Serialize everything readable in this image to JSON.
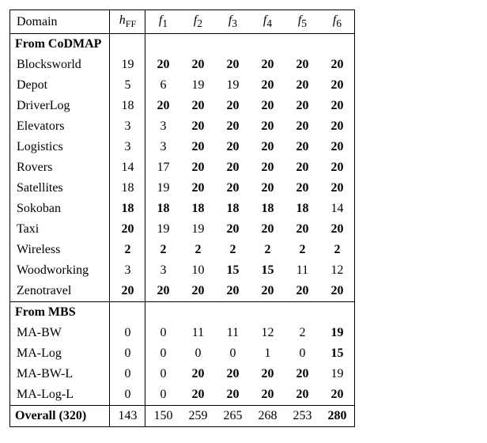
{
  "headers": [
    "Domain",
    "h_FF",
    "f_1",
    "f_2",
    "f_3",
    "f_4",
    "f_5",
    "f_6"
  ],
  "chart_data": {
    "type": "table",
    "columns": [
      "Domain",
      "h_FF",
      "f_1",
      "f_2",
      "f_3",
      "f_4",
      "f_5",
      "f_6"
    ],
    "sections": [
      {
        "title": "From CoDMAP",
        "rows": [
          {
            "domain": "Blocksworld",
            "values": [
              19,
              20,
              20,
              20,
              20,
              20,
              20
            ],
            "bold": [
              false,
              true,
              true,
              true,
              true,
              true,
              true
            ]
          },
          {
            "domain": "Depot",
            "values": [
              5,
              6,
              19,
              19,
              20,
              20,
              20
            ],
            "bold": [
              false,
              false,
              false,
              false,
              true,
              true,
              true
            ]
          },
          {
            "domain": "DriverLog",
            "values": [
              18,
              20,
              20,
              20,
              20,
              20,
              20
            ],
            "bold": [
              false,
              true,
              true,
              true,
              true,
              true,
              true
            ]
          },
          {
            "domain": "Elevators",
            "values": [
              3,
              3,
              20,
              20,
              20,
              20,
              20
            ],
            "bold": [
              false,
              false,
              true,
              true,
              true,
              true,
              true
            ]
          },
          {
            "domain": "Logistics",
            "values": [
              3,
              3,
              20,
              20,
              20,
              20,
              20
            ],
            "bold": [
              false,
              false,
              true,
              true,
              true,
              true,
              true
            ]
          },
          {
            "domain": "Rovers",
            "values": [
              14,
              17,
              20,
              20,
              20,
              20,
              20
            ],
            "bold": [
              false,
              false,
              true,
              true,
              true,
              true,
              true
            ]
          },
          {
            "domain": "Satellites",
            "values": [
              18,
              19,
              20,
              20,
              20,
              20,
              20
            ],
            "bold": [
              false,
              false,
              true,
              true,
              true,
              true,
              true
            ]
          },
          {
            "domain": "Sokoban",
            "values": [
              18,
              18,
              18,
              18,
              18,
              18,
              14
            ],
            "bold": [
              true,
              true,
              true,
              true,
              true,
              true,
              false
            ]
          },
          {
            "domain": "Taxi",
            "values": [
              20,
              19,
              19,
              20,
              20,
              20,
              20
            ],
            "bold": [
              true,
              false,
              false,
              true,
              true,
              true,
              true
            ]
          },
          {
            "domain": "Wireless",
            "values": [
              2,
              2,
              2,
              2,
              2,
              2,
              2
            ],
            "bold": [
              true,
              true,
              true,
              true,
              true,
              true,
              true
            ]
          },
          {
            "domain": "Woodworking",
            "values": [
              3,
              3,
              10,
              15,
              15,
              11,
              12
            ],
            "bold": [
              false,
              false,
              false,
              true,
              true,
              false,
              false
            ]
          },
          {
            "domain": "Zenotravel",
            "values": [
              20,
              20,
              20,
              20,
              20,
              20,
              20
            ],
            "bold": [
              true,
              true,
              true,
              true,
              true,
              true,
              true
            ]
          }
        ]
      },
      {
        "title": "From MBS",
        "rows": [
          {
            "domain": "MA-BW",
            "values": [
              0,
              0,
              11,
              11,
              12,
              2,
              19
            ],
            "bold": [
              false,
              false,
              false,
              false,
              false,
              false,
              true
            ]
          },
          {
            "domain": "MA-Log",
            "values": [
              0,
              0,
              0,
              0,
              1,
              0,
              15
            ],
            "bold": [
              false,
              false,
              false,
              false,
              false,
              false,
              true
            ]
          },
          {
            "domain": "MA-BW-L",
            "values": [
              0,
              0,
              20,
              20,
              20,
              20,
              19
            ],
            "bold": [
              false,
              false,
              true,
              true,
              true,
              true,
              false
            ]
          },
          {
            "domain": "MA-Log-L",
            "values": [
              0,
              0,
              20,
              20,
              20,
              20,
              20
            ],
            "bold": [
              false,
              false,
              true,
              true,
              true,
              true,
              true
            ]
          }
        ]
      }
    ],
    "overall": {
      "label": "Overall (320)",
      "values": [
        143,
        150,
        259,
        265,
        268,
        253,
        280
      ],
      "bold": [
        false,
        false,
        false,
        false,
        false,
        false,
        true
      ]
    }
  }
}
